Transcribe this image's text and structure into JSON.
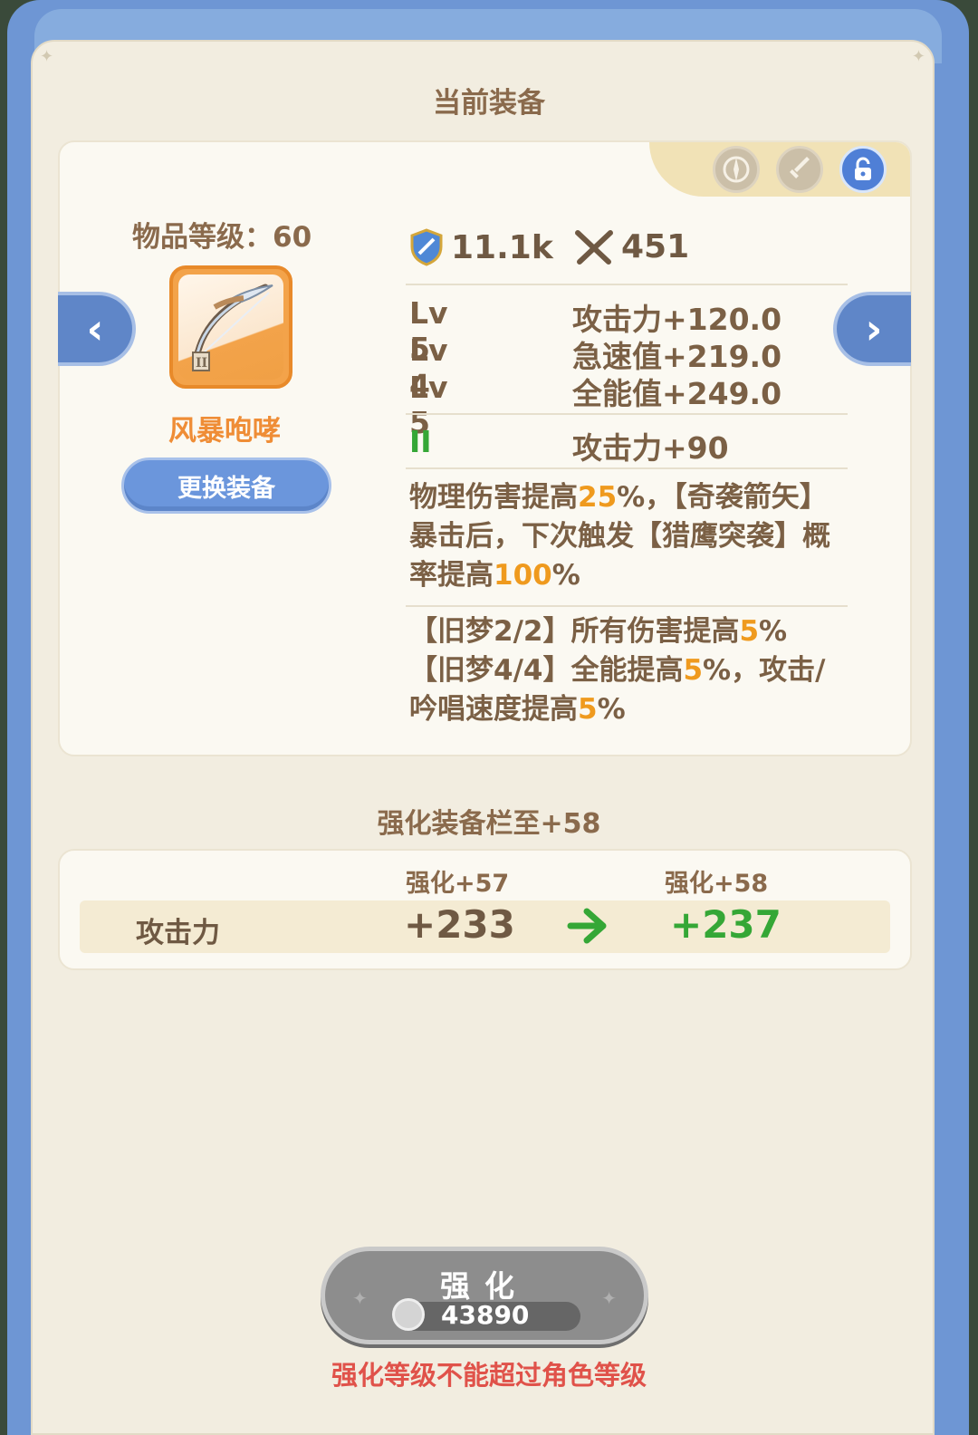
{
  "current_equipment": {
    "title": "当前装备",
    "item_level_label": "物品等级：60",
    "item_name": "风暴咆哮",
    "swap_button": "更换装备",
    "icon_names": [
      "compass-icon",
      "sword-icon",
      "lock-icon"
    ],
    "gear_score": "11.1k",
    "attack_power": "451",
    "affixes": [
      {
        "level": "Lv 5",
        "stat": "攻击力+120.0"
      },
      {
        "level": "Lv 4",
        "stat": "急速值+219.0"
      },
      {
        "level": "Lv 5",
        "stat": "全能值+249.0"
      }
    ],
    "tier_tag": "II",
    "tier_stat": "攻击力+90",
    "special_effect": [
      {
        "text": "物理伤害提高",
        "hl": false
      },
      {
        "text": "25",
        "hl": true
      },
      {
        "text": "%，【奇袭箭矢】暴击后，下次触发【猎鹰突袭】概率提高",
        "hl": false
      },
      {
        "text": "100",
        "hl": true
      },
      {
        "text": "%",
        "hl": false
      }
    ],
    "set_bonus": [
      {
        "text": "【旧梦2/2】所有伤害提高",
        "hl": false
      },
      {
        "text": "5",
        "hl": true
      },
      {
        "text": "%",
        "hl": false
      },
      {
        "text": "【旧梦4/4】全能提高",
        "hl": false,
        "newline": true
      },
      {
        "text": "5",
        "hl": true
      },
      {
        "text": "%，攻击/吟唱速度提高",
        "hl": false
      },
      {
        "text": "5",
        "hl": true
      },
      {
        "text": "%",
        "hl": false
      }
    ]
  },
  "enhance": {
    "title": "强化装备栏至+58",
    "current_header": "强化+57",
    "next_header": "强化+58",
    "stat_label": "攻击力",
    "current_value": "+233",
    "next_value": "+237",
    "button_label": "强化",
    "cost": "43890",
    "warning": "强化等级不能超过角色等级"
  },
  "colors": {
    "accent_orange": "#ef9a1e",
    "positive_green": "#35a736",
    "frame_blue": "#6e96d4",
    "warning_red": "#e0524a"
  }
}
